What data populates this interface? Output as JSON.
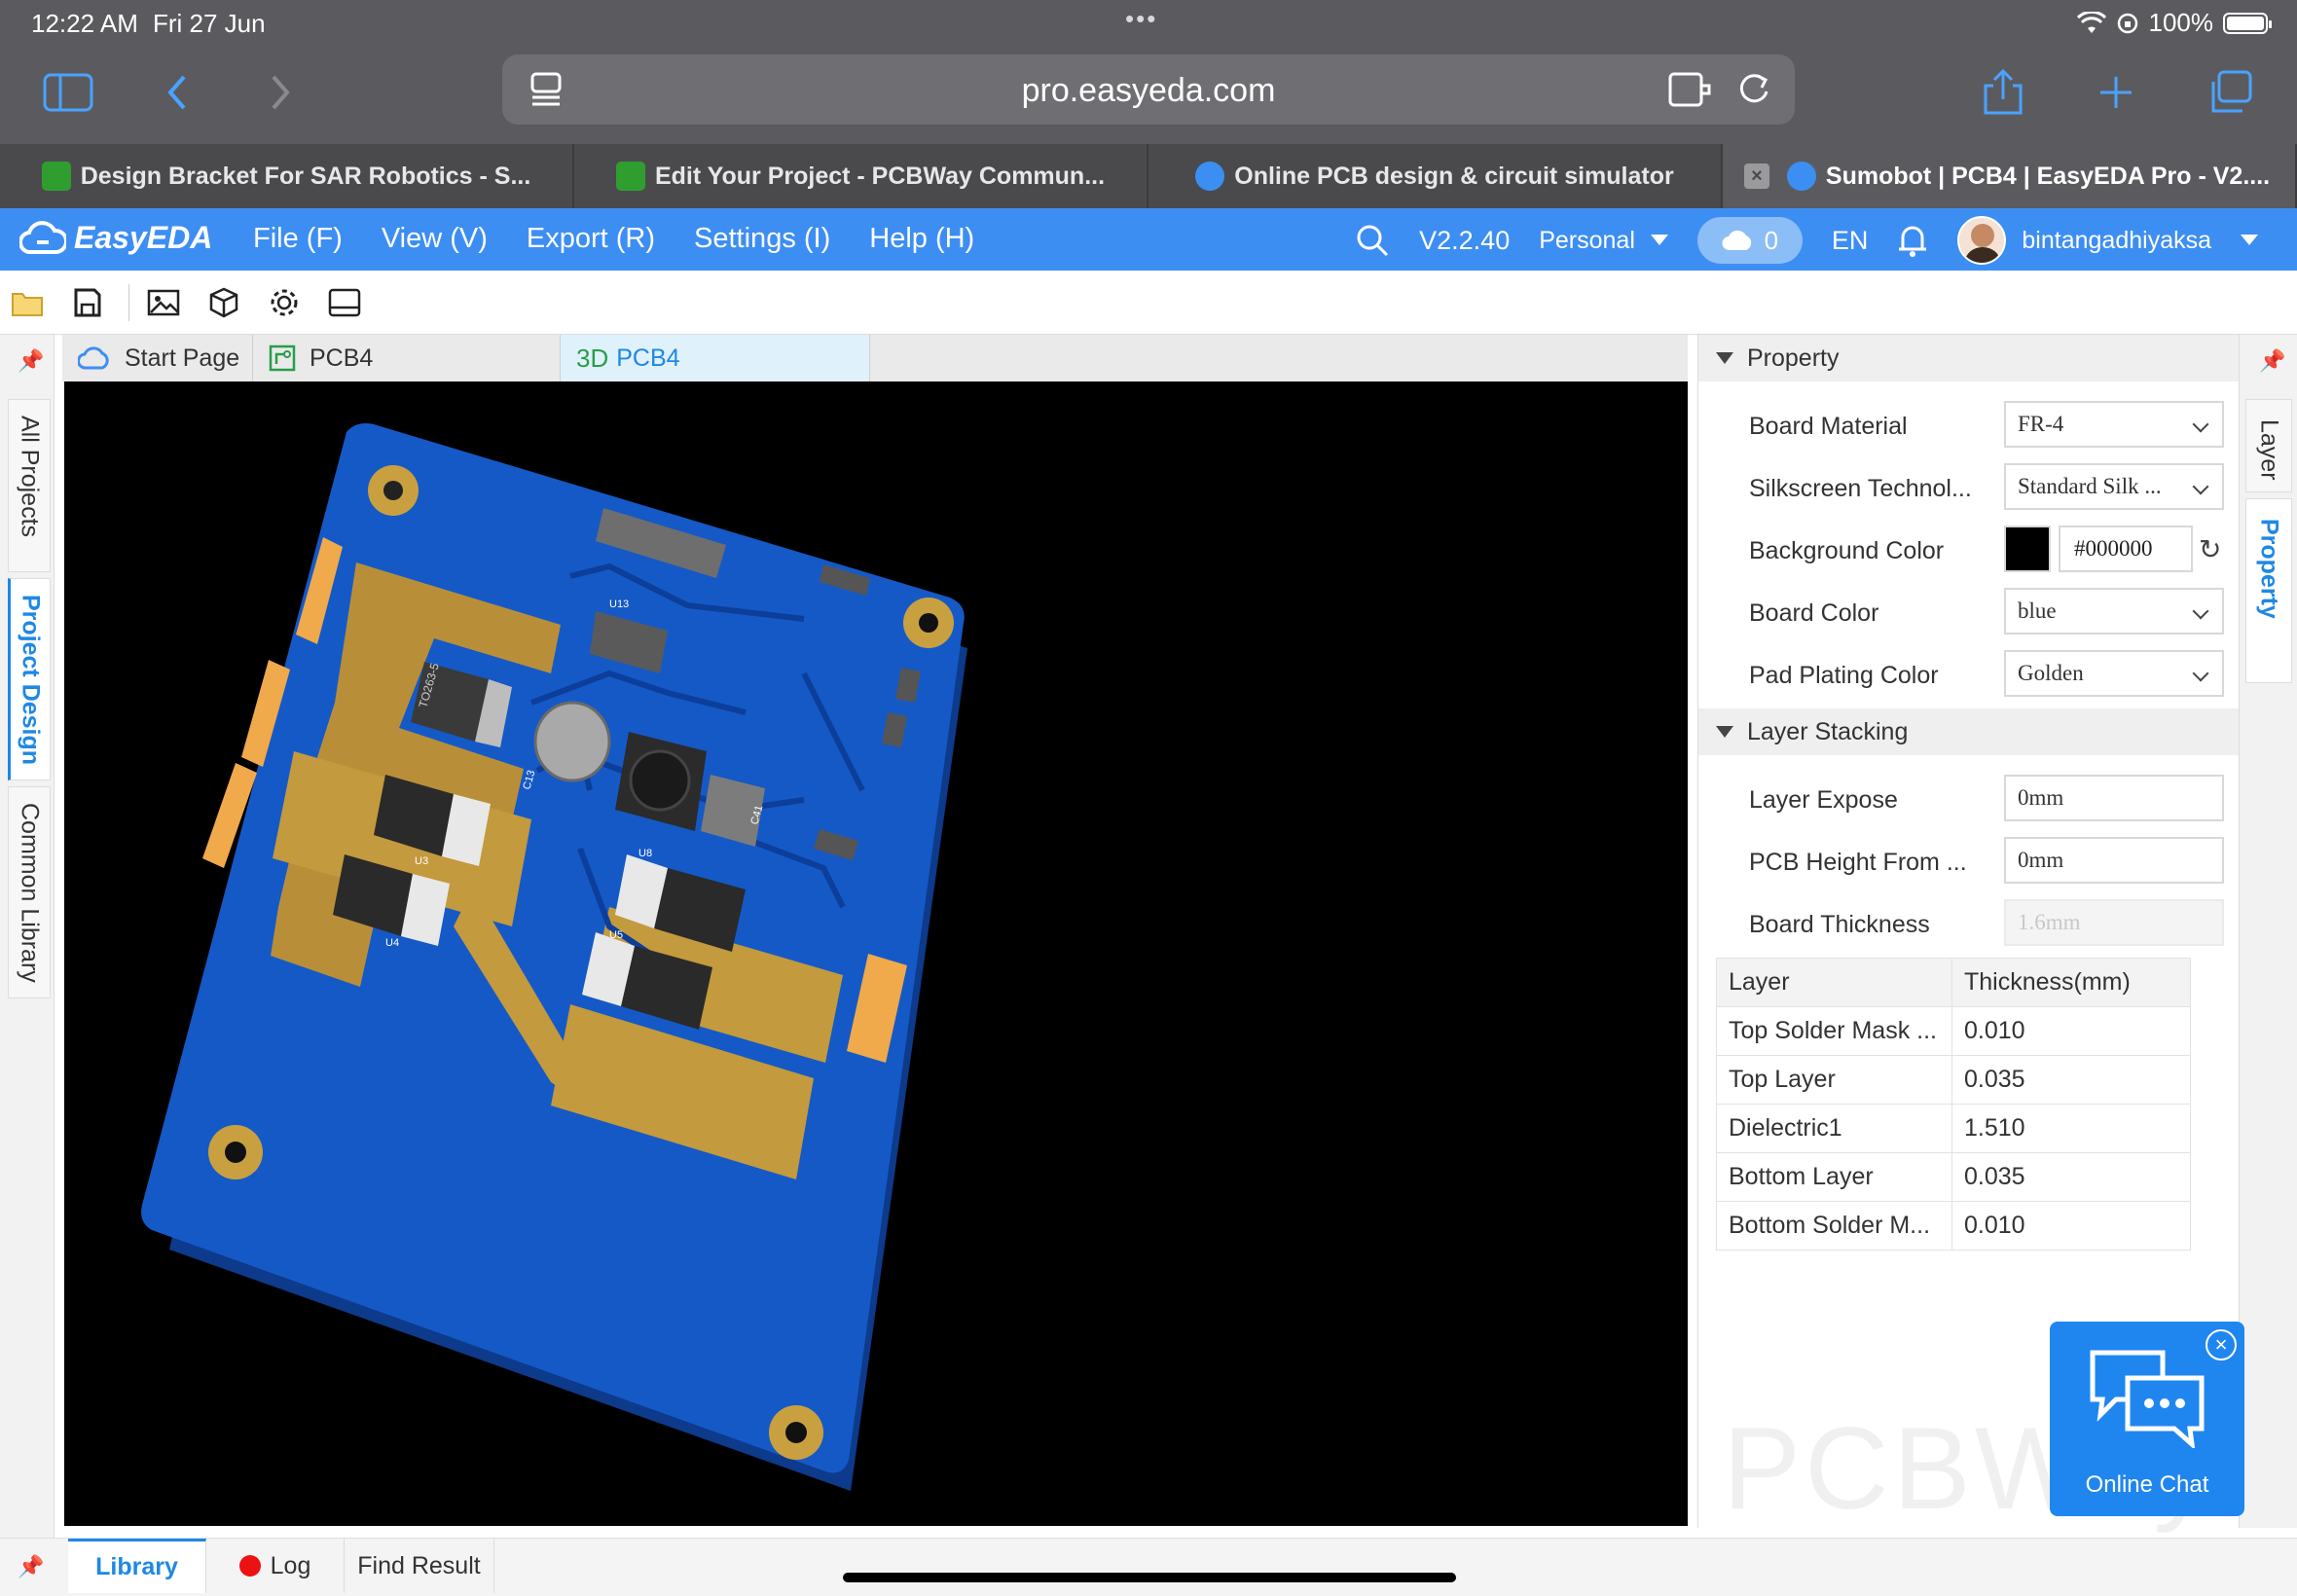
{
  "status": {
    "time": "12:22 AM",
    "date": "Fri 27 Jun",
    "battery": "100%"
  },
  "browser": {
    "url": "pro.easyeda.com",
    "tabs": [
      {
        "label": "Design Bracket For SAR Robotics - S...",
        "favicon": "pcbway-icon"
      },
      {
        "label": "Edit Your Project - PCBWay Commun...",
        "favicon": "pcbway-icon"
      },
      {
        "label": "Online PCB design & circuit simulator",
        "favicon": "easyeda-icon"
      },
      {
        "label": "Sumobot | PCB4 | EasyEDA Pro - V2....",
        "favicon": "easyeda-icon"
      }
    ]
  },
  "app": {
    "logo": "EasyEDA",
    "menu": [
      "File (F)",
      "View (V)",
      "Export (R)",
      "Settings (I)",
      "Help (H)"
    ],
    "version": "V2.2.40",
    "workspace": "Personal",
    "cloud_count": "0",
    "language": "EN",
    "username": "bintangadhiyaksa",
    "accent": "#3d8ef3"
  },
  "left_tabs": [
    "All Projects",
    "Project Design",
    "Common Library"
  ],
  "doc_tabs": [
    {
      "label": "Start Page"
    },
    {
      "label": "PCB4"
    },
    {
      "prefix": "3D",
      "label": "PCB4"
    }
  ],
  "property": {
    "section": "Property",
    "board_material_label": "Board Material",
    "board_material": "FR-4",
    "silkscreen_label": "Silkscreen Technol...",
    "silkscreen": "Standard Silk ...",
    "bg_color_label": "Background Color",
    "bg_color": "#000000",
    "board_color_label": "Board Color",
    "board_color": "blue",
    "pad_plating_label": "Pad Plating Color",
    "pad_plating": "Golden"
  },
  "stacking": {
    "section": "Layer Stacking",
    "layer_expose_label": "Layer Expose",
    "layer_expose": "0mm",
    "pcb_height_label": "PCB Height From ...",
    "pcb_height": "0mm",
    "board_thickness_label": "Board Thickness",
    "board_thickness": "1.6mm",
    "table_headers": [
      "Layer",
      "Thickness(mm)"
    ],
    "rows": [
      [
        "Top Solder Mask ...",
        "0.010"
      ],
      [
        "Top Layer",
        "0.035"
      ],
      [
        "Dielectric1",
        "1.510"
      ],
      [
        "Bottom Layer",
        "0.035"
      ],
      [
        "Bottom Solder M...",
        "0.010"
      ]
    ]
  },
  "right_tabs": [
    "Layer",
    "Property"
  ],
  "chat": {
    "label": "Online Chat",
    "watermark": "PCBWay"
  },
  "bottom_tabs": [
    "Library",
    "Log",
    "Find Result"
  ],
  "board_labels": {
    "u3": "U3",
    "u4": "U4",
    "u8": "U8",
    "u5": "U5",
    "u13": "U13",
    "c13": "C13",
    "c41": "C41",
    "chip": "TO263-5"
  }
}
